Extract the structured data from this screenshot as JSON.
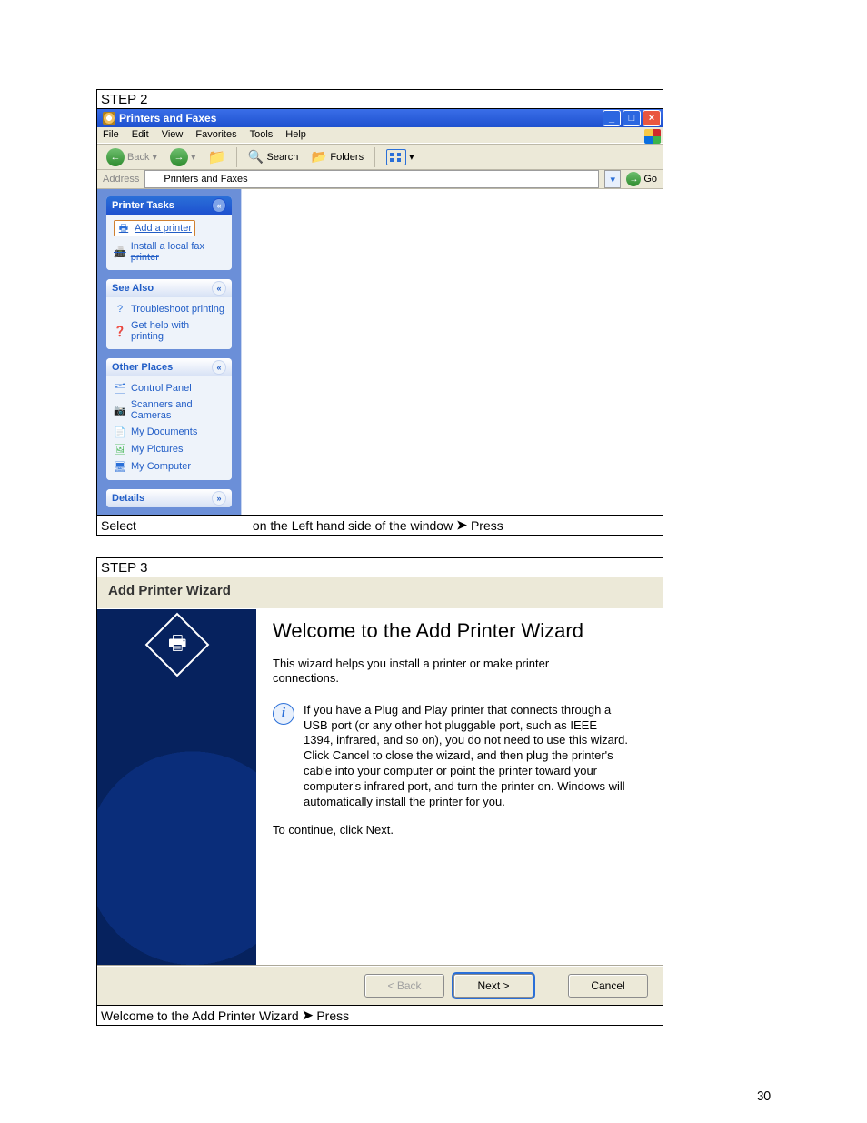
{
  "page_number": "30",
  "step2": {
    "label": "STEP 2",
    "caption_select": "Select",
    "caption_rest": "on the Left hand side of the window",
    "caption_press": "Press",
    "window": {
      "title": "Printers and Faxes",
      "menu": [
        "File",
        "Edit",
        "View",
        "Favorites",
        "Tools",
        "Help"
      ],
      "toolbar": {
        "back": "Back",
        "search": "Search",
        "folders": "Folders"
      },
      "address_label": "Address",
      "address_value": "Printers and Faxes",
      "go": "Go",
      "panels": {
        "printer_tasks": {
          "title": "Printer Tasks",
          "items": [
            {
              "label": "Add a printer",
              "icon": "printer-icon",
              "highlight": true
            },
            {
              "label": "Install a local fax printer",
              "icon": "fax-icon",
              "highlight": false
            }
          ]
        },
        "see_also": {
          "title": "See Also",
          "items": [
            {
              "label": "Troubleshoot printing",
              "icon": "help-icon"
            },
            {
              "label": "Get help with printing",
              "icon": "help-round-icon"
            }
          ]
        },
        "other_places": {
          "title": "Other Places",
          "items": [
            {
              "label": "Control Panel",
              "icon": "control-panel-icon"
            },
            {
              "label": "Scanners and Cameras",
              "icon": "camera-icon"
            },
            {
              "label": "My Documents",
              "icon": "documents-icon"
            },
            {
              "label": "My Pictures",
              "icon": "pictures-icon"
            },
            {
              "label": "My Computer",
              "icon": "computer-icon"
            }
          ]
        },
        "details": {
          "title": "Details"
        }
      }
    }
  },
  "step3": {
    "label": "STEP 3",
    "caption_a": "Welcome to the Add Printer Wizard",
    "caption_b": "Press",
    "wizard": {
      "title": "Add Printer Wizard",
      "heading": "Welcome to the Add Printer Wizard",
      "intro": "This wizard helps you install a printer or make printer connections.",
      "info": "If you have a Plug and Play printer that connects through a USB port (or any other hot pluggable port, such as IEEE 1394, infrared, and so on), you do not need to use this wizard. Click Cancel to close the wizard, and then plug the printer's cable into your computer or point the printer toward your computer's infrared port, and turn the printer on. Windows will automatically install the printer for you.",
      "continue": "To continue, click Next.",
      "buttons": {
        "back": "< Back",
        "next": "Next >",
        "cancel": "Cancel"
      }
    }
  }
}
